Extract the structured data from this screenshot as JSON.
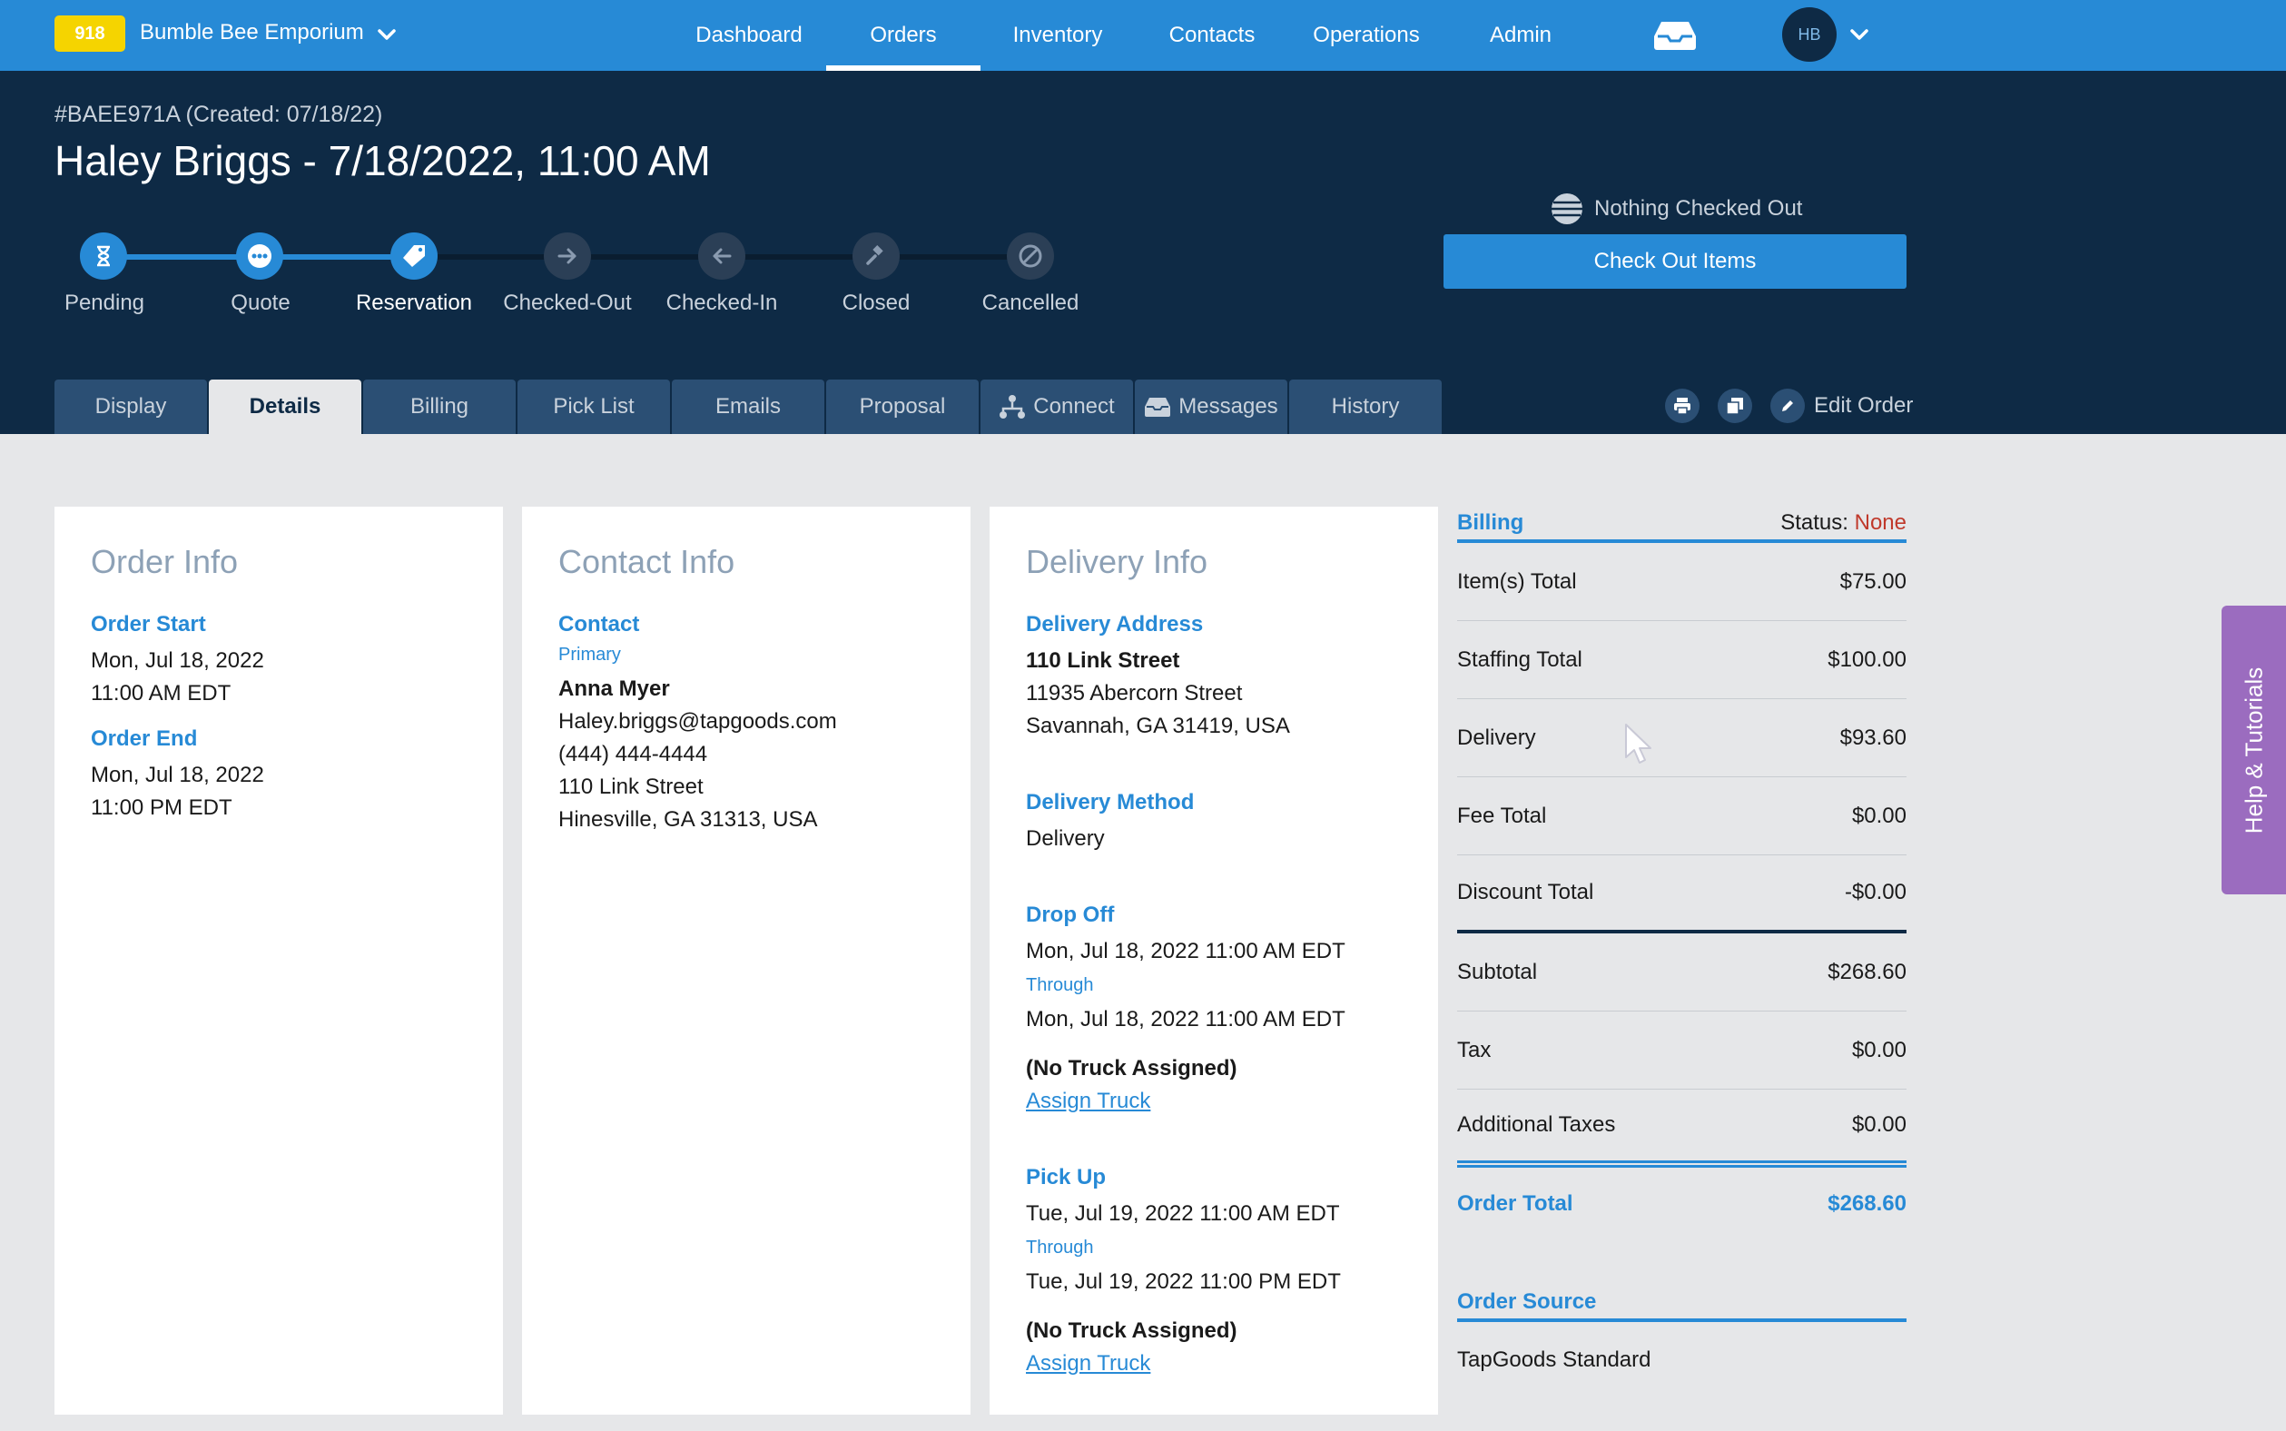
{
  "topnav": {
    "business_badge": "918",
    "business_name": "Bumble Bee Emporium",
    "items": [
      {
        "label": "Dashboard"
      },
      {
        "label": "Orders"
      },
      {
        "label": "Inventory"
      },
      {
        "label": "Contacts"
      },
      {
        "label": "Operations"
      },
      {
        "label": "Admin"
      }
    ],
    "active_item": "Orders",
    "avatar_initials": "HB"
  },
  "header": {
    "order_id": "#BAEE971A (Created: 07/18/22)",
    "title": "Haley Briggs - 7/18/2022, 11:00 AM",
    "steps": [
      {
        "label": "Pending",
        "state": "done",
        "icon": "hourglass-icon"
      },
      {
        "label": "Quote",
        "state": "done",
        "icon": "ellipsis-icon"
      },
      {
        "label": "Reservation",
        "state": "current",
        "icon": "tag-icon"
      },
      {
        "label": "Checked-Out",
        "state": "todo",
        "icon": "arrow-right-icon"
      },
      {
        "label": "Checked-In",
        "state": "todo",
        "icon": "arrow-left-icon"
      },
      {
        "label": "Closed",
        "state": "todo",
        "icon": "gavel-icon"
      },
      {
        "label": "Cancelled",
        "state": "todo",
        "icon": "cancel-icon"
      }
    ],
    "checked_status": "Nothing Checked Out",
    "checkout_button": "Check Out Items",
    "tabs": [
      {
        "label": "Display"
      },
      {
        "label": "Details"
      },
      {
        "label": "Billing"
      },
      {
        "label": "Pick List"
      },
      {
        "label": "Emails"
      },
      {
        "label": "Proposal"
      },
      {
        "label": "Connect"
      },
      {
        "label": "Messages"
      },
      {
        "label": "History"
      }
    ],
    "active_tab": "Details",
    "edit_order": "Edit Order"
  },
  "order_info": {
    "title": "Order Info",
    "start_label": "Order Start",
    "start_date": "Mon, Jul 18, 2022",
    "start_time": "11:00 AM EDT",
    "end_label": "Order End",
    "end_date": "Mon, Jul 18, 2022",
    "end_time": "11:00 PM EDT"
  },
  "contact_info": {
    "title": "Contact Info",
    "label": "Contact",
    "role": "Primary",
    "name": "Anna Myer",
    "email": "Haley.briggs@tapgoods.com",
    "phone": "(444) 444-4444",
    "street": "110 Link Street",
    "city": "Hinesville, GA 31313, USA"
  },
  "delivery_info": {
    "title": "Delivery Info",
    "address_label": "Delivery Address",
    "address_name": "110 Link Street",
    "address_street": "11935 Abercorn Street",
    "address_city": "Savannah, GA 31419, USA",
    "method_label": "Delivery Method",
    "method": "Delivery",
    "dropoff_label": "Drop Off",
    "dropoff_start": "Mon, Jul 18, 2022 11:00 AM EDT",
    "through": "Through",
    "dropoff_end": "Mon, Jul 18, 2022 11:00 AM EDT",
    "no_truck": "(No Truck Assigned)",
    "assign_truck": "Assign Truck",
    "pickup_label": "Pick Up",
    "pickup_start": "Tue, Jul 19, 2022 11:00 AM EDT",
    "pickup_end": "Tue, Jul 19, 2022 11:00 PM EDT"
  },
  "billing": {
    "title": "Billing",
    "status_label": "Status:",
    "status_value": "None",
    "rows": [
      {
        "label": "Item(s) Total",
        "value": "$75.00"
      },
      {
        "label": "Staffing Total",
        "value": "$100.00"
      },
      {
        "label": "Delivery",
        "value": "$93.60"
      },
      {
        "label": "Fee Total",
        "value": "$0.00"
      },
      {
        "label": "Discount Total",
        "value": "-$0.00"
      },
      {
        "label": "Subtotal",
        "value": "$268.60"
      },
      {
        "label": "Tax",
        "value": "$0.00"
      },
      {
        "label": "Additional Taxes",
        "value": "$0.00"
      }
    ],
    "total_label": "Order Total",
    "total_value": "$268.60",
    "source_label": "Order Source",
    "source_value": "TapGoods Standard"
  },
  "help": {
    "label": "Help & Tutorials"
  },
  "colors": {
    "nav_blue": "#278ad6",
    "header_navy": "#0e2a45",
    "badge_yellow": "#f5d400",
    "status_red": "#c0392b",
    "help_purple": "#9b6cbf"
  }
}
